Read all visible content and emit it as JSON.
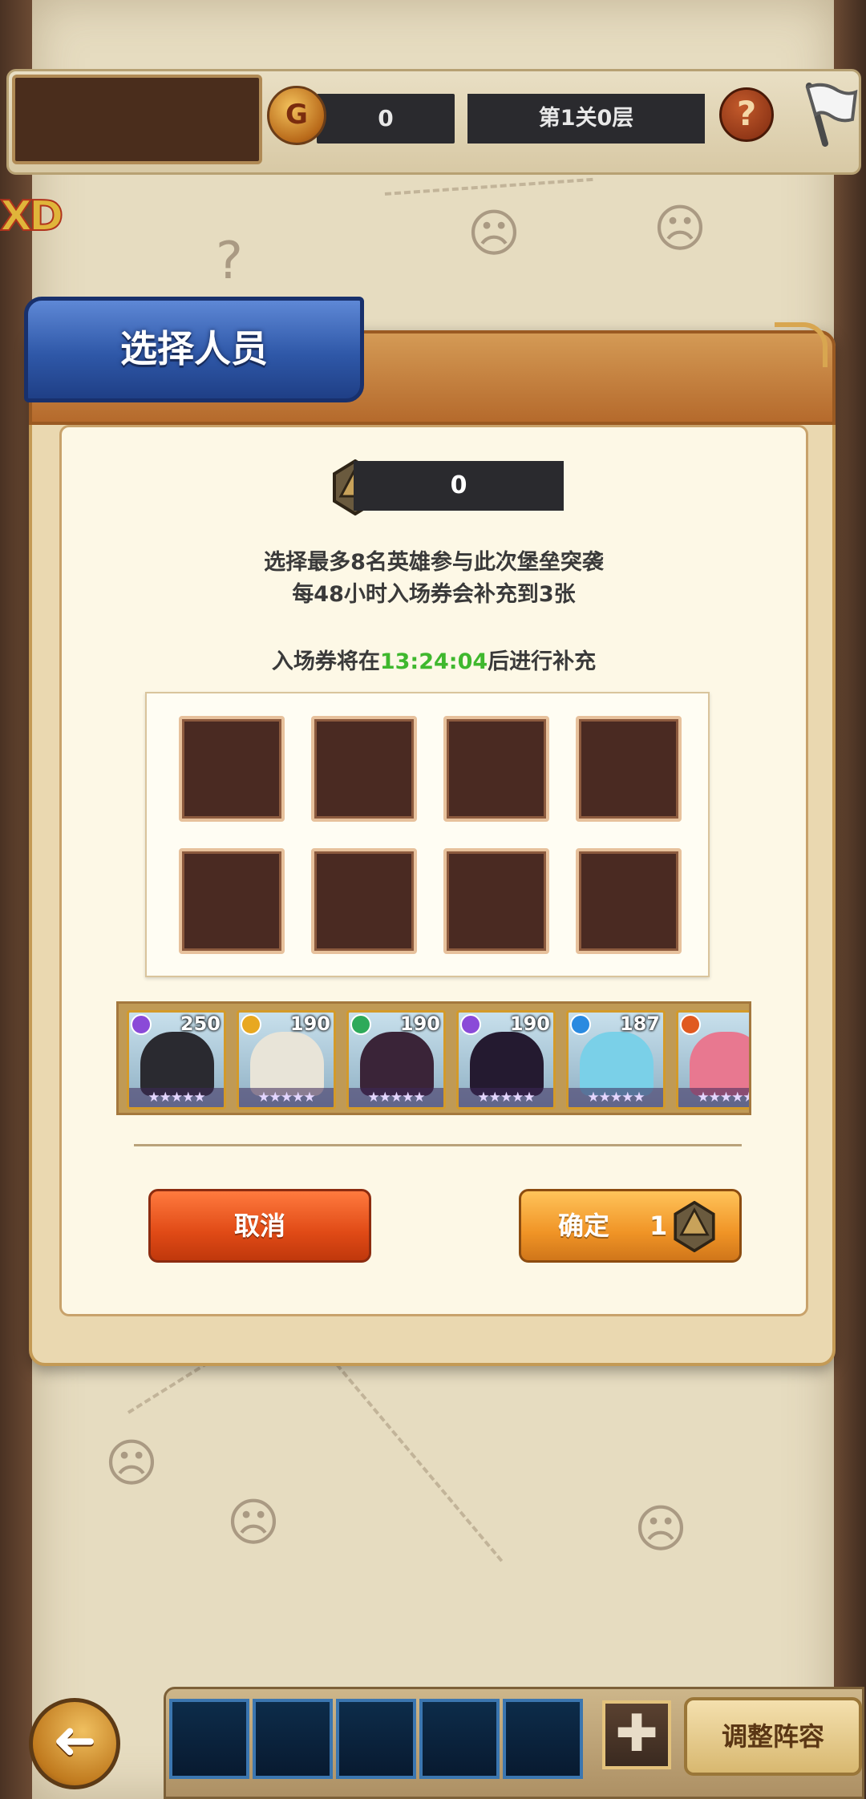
{
  "hud": {
    "coin_icon_glyph": "G",
    "coin_value": "0",
    "stage": "第1关0层",
    "help_glyph": "?",
    "corner_mark": "XD"
  },
  "dialog": {
    "title": "选择人员",
    "ticket_value": "0",
    "desc_line_1": "选择最多8名英雄参与此次堡垒突袭",
    "desc_line_2": "每48小时入场券会补充到3张",
    "timer_prefix": "入场券将在",
    "timer_value": "13:24:04",
    "timer_suffix": "后进行补充",
    "slot_count": 8,
    "heroes": [
      {
        "level": "250",
        "element_color": "#8a4ad8",
        "stars": "★★★★★",
        "art_color": "#2a2a30"
      },
      {
        "level": "190",
        "element_color": "#e8a820",
        "stars": "★★★★★",
        "art_color": "#e8e4d8"
      },
      {
        "level": "190",
        "element_color": "#2eaa5a",
        "stars": "★★★★★",
        "art_color": "#3a2438"
      },
      {
        "level": "190",
        "element_color": "#8a4ad8",
        "stars": "★★★★★",
        "art_color": "#241a30"
      },
      {
        "level": "187",
        "element_color": "#2a8ae0",
        "stars": "★★★★★",
        "art_color": "#7ad0e8"
      },
      {
        "level": "",
        "element_color": "#e05a20",
        "stars": "★★★★★",
        "art_color": "#e87890"
      }
    ],
    "cancel_label": "取消",
    "confirm_label": "确定",
    "confirm_cost": "1"
  },
  "bottom": {
    "back_glyph": "➜",
    "add_glyph": "✚",
    "adjust_team_label": "调整阵容",
    "team_slot_count": 5
  },
  "colors": {
    "timer_green": "#3fb82e",
    "title_tab_blue": "#2f58a8",
    "cancel_orange": "#e04a16",
    "confirm_orange": "#f09426"
  }
}
